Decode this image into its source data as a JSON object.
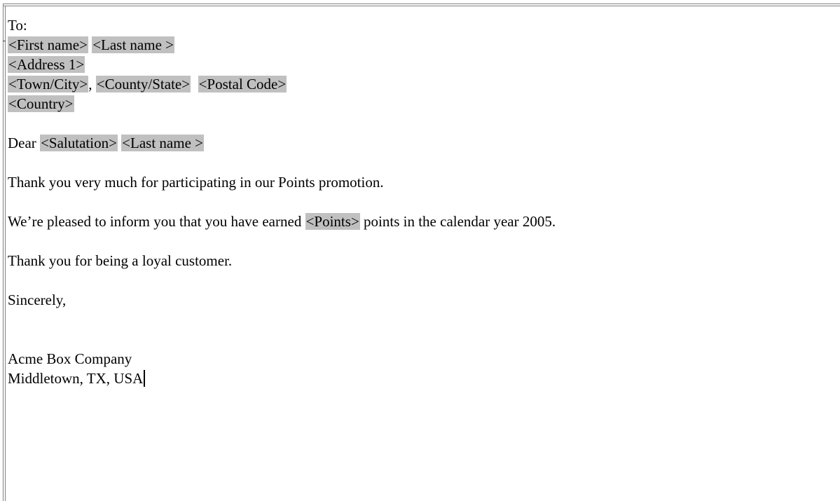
{
  "letter": {
    "to_label": "To:",
    "first_name_field": "<First name>",
    "last_name_field": "<Last name >",
    "address1_field": "<Address 1>",
    "town_field": "<Town/City>",
    "town_sep": ", ",
    "state_field": "<County/State>",
    "postal_field": "<Postal Code>",
    "country_field": "<Country>",
    "dear_text": "Dear ",
    "salutation_field": "<Salutation>",
    "dear_last_name_field": "<Last name >",
    "para1": "Thank you very much for participating in our Points promotion.",
    "para2_before": "We’re pleased to inform you that you have earned ",
    "points_field": "<Points>",
    "para2_after": " points in the calendar year 2005.",
    "para3": "Thank you for being a loyal customer.",
    "closing": "Sincerely,",
    "company": "Acme Box Company",
    "location": "Middletown, TX, USA"
  },
  "colors": {
    "field_shading": "#c0c0c0",
    "text": "#000000",
    "frame": "#808080"
  }
}
